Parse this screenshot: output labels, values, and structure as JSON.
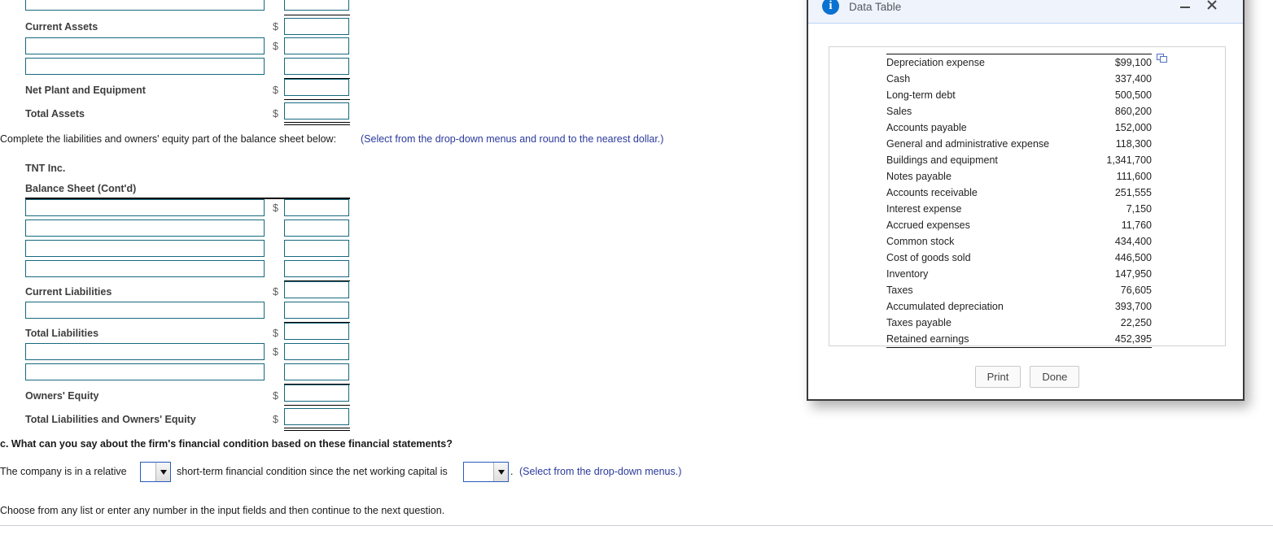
{
  "form": {
    "asset_rows": [
      {
        "label": "",
        "dollar": false,
        "type": "input"
      },
      {
        "label": "Current Assets",
        "dollar": true,
        "type": "label"
      },
      {
        "label": "",
        "dollar": true,
        "type": "input"
      },
      {
        "label": "",
        "dollar": false,
        "type": "input"
      },
      {
        "label": "Net Plant and Equipment",
        "dollar": true,
        "type": "label"
      },
      {
        "label": "Total Assets",
        "dollar": true,
        "type": "label"
      }
    ],
    "instruction": "Complete the liabilities and owners' equity part of the balance sheet below:",
    "instruction_note": "(Select from the drop-down menus and round to the nearest dollar.)",
    "company_name": "TNT Inc.",
    "statement_title": "Balance Sheet (Cont'd)",
    "liability_rows": [
      {
        "label": "",
        "dollar": true,
        "type": "input"
      },
      {
        "label": "",
        "dollar": false,
        "type": "input"
      },
      {
        "label": "",
        "dollar": false,
        "type": "input"
      },
      {
        "label": "",
        "dollar": false,
        "type": "input"
      },
      {
        "label": "Current Liabilities",
        "dollar": true,
        "type": "label"
      },
      {
        "label": "",
        "dollar": false,
        "type": "input"
      },
      {
        "label": "Total Liabilities",
        "dollar": true,
        "type": "label"
      },
      {
        "label": "",
        "dollar": true,
        "type": "input"
      },
      {
        "label": "",
        "dollar": false,
        "type": "input"
      },
      {
        "label": "Owners' Equity",
        "dollar": true,
        "type": "label"
      },
      {
        "label": "Total Liabilities and Owners' Equity",
        "dollar": true,
        "type": "label"
      }
    ]
  },
  "question_c": {
    "prompt": "c. What can you say about the firm's financial condition based on these financial statements?",
    "sentence_part1": "The company is in a relative",
    "sentence_part2": "short-term financial condition since the net working capital is",
    "sentence_part3": ".",
    "note": "(Select from the drop-down menus.)",
    "select1_value": "",
    "select2_value": ""
  },
  "footer": {
    "hint": "Choose from any list or enter any number in the input fields and then continue to the next question."
  },
  "dialog": {
    "title": "Data Table",
    "info_badge": "i",
    "minimize_label": "minimize-icon",
    "close_label": "close-icon",
    "copy_icon_label": "copy-icon",
    "print_label": "Print",
    "done_label": "Done",
    "rows": [
      {
        "label": "Depreciation expense",
        "value": "$99,100"
      },
      {
        "label": "Cash",
        "value": "337,400"
      },
      {
        "label": "Long-term debt",
        "value": "500,500"
      },
      {
        "label": "Sales",
        "value": "860,200"
      },
      {
        "label": "Accounts payable",
        "value": "152,000"
      },
      {
        "label": "General and administrative expense",
        "value": "118,300"
      },
      {
        "label": "Buildings and equipment",
        "value": "1,341,700"
      },
      {
        "label": "Notes payable",
        "value": "111,600"
      },
      {
        "label": "Accounts receivable",
        "value": "251,555"
      },
      {
        "label": "Interest expense",
        "value": "7,150"
      },
      {
        "label": "Accrued expenses",
        "value": "11,760"
      },
      {
        "label": "Common stock",
        "value": "434,400"
      },
      {
        "label": "Cost of goods sold",
        "value": "446,500"
      },
      {
        "label": "Inventory",
        "value": "147,950"
      },
      {
        "label": "Taxes",
        "value": "76,605"
      },
      {
        "label": "Accumulated depreciation",
        "value": "393,700"
      },
      {
        "label": "Taxes payable",
        "value": "22,250"
      },
      {
        "label": "Retained earnings",
        "value": "452,395"
      }
    ]
  },
  "colors": {
    "input_border": "#17697f",
    "dialog_header_bg": "#eff3fc",
    "info_badge": "#0a72d0",
    "note_text": "#2b3a9c"
  }
}
